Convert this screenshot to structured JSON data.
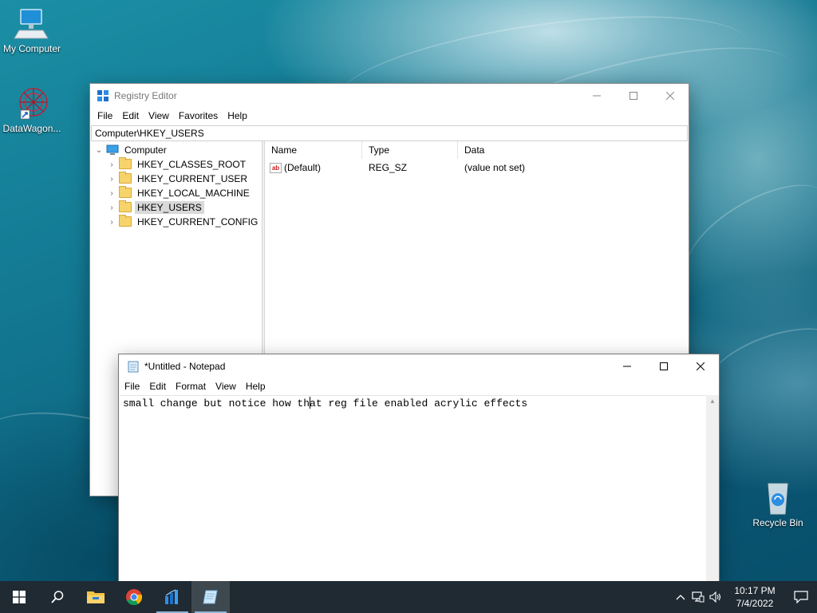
{
  "desktop": {
    "icons": [
      {
        "label": "My Computer",
        "icon": "computer-icon"
      },
      {
        "label": "DataWagon...",
        "icon": "datawagon-shortcut-icon"
      },
      {
        "label": "Recycle Bin",
        "icon": "recycle-bin-icon"
      }
    ]
  },
  "regedit": {
    "title": "Registry Editor",
    "menu": [
      "File",
      "Edit",
      "View",
      "Favorites",
      "Help"
    ],
    "address": "Computer\\HKEY_USERS",
    "tree": {
      "root": "Computer",
      "items": [
        {
          "label": "HKEY_CLASSES_ROOT",
          "selected": false
        },
        {
          "label": "HKEY_CURRENT_USER",
          "selected": false
        },
        {
          "label": "HKEY_LOCAL_MACHINE",
          "selected": false
        },
        {
          "label": "HKEY_USERS",
          "selected": true
        },
        {
          "label": "HKEY_CURRENT_CONFIG",
          "selected": false
        }
      ]
    },
    "columns": [
      "Name",
      "Type",
      "Data"
    ],
    "values": [
      {
        "name": "(Default)",
        "type": "REG_SZ",
        "data": "(value not set)"
      }
    ]
  },
  "notepad": {
    "title": "*Untitled - Notepad",
    "menu": [
      "File",
      "Edit",
      "Format",
      "View",
      "Help"
    ],
    "text_before_caret": "small change but notice how th",
    "text_after_caret": "at reg file enabled acrylic effects"
  },
  "taskbar": {
    "apps": [
      {
        "name": "File Explorer",
        "icon": "file-explorer-icon",
        "running": false,
        "active": false
      },
      {
        "name": "Google Chrome",
        "icon": "chrome-icon",
        "running": false,
        "active": false
      },
      {
        "name": "Registry Editor",
        "icon": "regedit-icon",
        "running": true,
        "active": false
      },
      {
        "name": "Notepad",
        "icon": "notepad-icon",
        "running": true,
        "active": true
      }
    ],
    "time": "10:17 PM",
    "date": "7/4/2022"
  },
  "colors": {
    "taskbar": "#1f2a33",
    "selection": "#d9d9d9",
    "folder": "#f7d36b"
  }
}
